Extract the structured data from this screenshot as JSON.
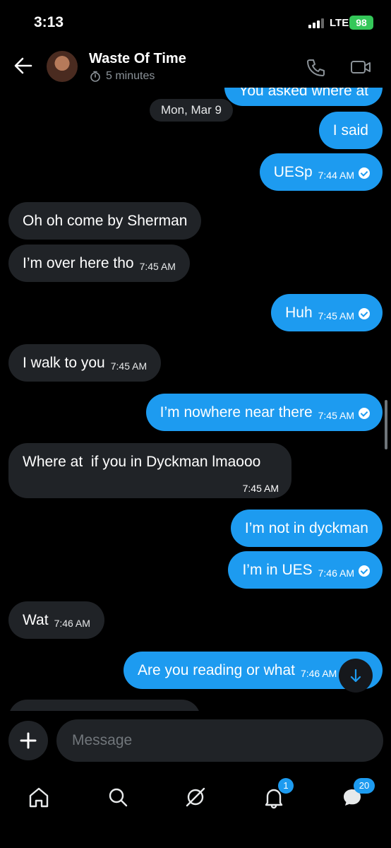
{
  "status": {
    "time": "3:13",
    "network": "LTE",
    "battery": "98"
  },
  "header": {
    "title": "Waste Of Time",
    "timer": "5 minutes"
  },
  "conversation": {
    "partial_top": "You asked where at",
    "date_separator": "Mon, Mar 9",
    "messages": [
      {
        "text": "I said",
        "time": ""
      },
      {
        "text": "UESp",
        "time": "7:44 AM"
      },
      {
        "text": "Oh oh come by Sherman",
        "time": ""
      },
      {
        "text": "I’m over here tho",
        "time": "7:45 AM"
      },
      {
        "text": "Huh",
        "time": "7:45 AM"
      },
      {
        "text": "I walk to you",
        "time": "7:45 AM"
      },
      {
        "text": "I’m nowhere near there",
        "time": "7:45 AM"
      },
      {
        "text": "Where at  if you in Dyckman lmaooo",
        "time": "7:45 AM"
      },
      {
        "text": "I’m not in dyckman",
        "time": ""
      },
      {
        "text": "I’m in UES",
        "time": "7:46 AM"
      },
      {
        "text": "Wat",
        "time": "7:46 AM"
      },
      {
        "text": "Are you reading or what",
        "time": "7:46 AM"
      }
    ]
  },
  "composer": {
    "placeholder": "Message"
  },
  "nav": {
    "notifications_badge": "1",
    "messages_badge": "20"
  },
  "colors": {
    "accent": "#1d9bf0",
    "incoming_bubble": "#202327",
    "background": "#000000",
    "battery": "#34c759"
  }
}
